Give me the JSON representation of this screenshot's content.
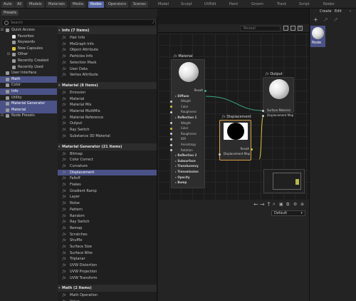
{
  "left_tabs": [
    "Auto",
    "All",
    "Models",
    "Materials",
    "Media",
    "Nodes",
    "Operators",
    "Scenes"
  ],
  "left_active_tab": "Nodes",
  "top_tabs": [
    "Model",
    "Sculpt",
    "UVEdit",
    "Paint",
    "Groom",
    "Track",
    "Script",
    "Nodes"
  ],
  "presets_tab": "Presets",
  "search": {
    "placeholder": "Search"
  },
  "tree": [
    {
      "label": "Quick Access",
      "expand": "⊟",
      "depth": 0,
      "icon": "#9a9a9a",
      "selected": false
    },
    {
      "label": "Favorites",
      "expand": "",
      "depth": 1,
      "icon": "#e0e0e0",
      "selected": false
    },
    {
      "label": "Keywords",
      "expand": "",
      "depth": 1,
      "icon": "#9a9a9a",
      "selected": false
    },
    {
      "label": "New Capsules",
      "expand": "",
      "depth": 1,
      "icon": "#d8c23a",
      "selected": false
    },
    {
      "label": "Other",
      "expand": "⊟",
      "depth": 1,
      "icon": "#9a9a9a",
      "selected": false
    },
    {
      "label": "Recently Created",
      "expand": "",
      "depth": 1,
      "icon": "#9a9a9a",
      "selected": false
    },
    {
      "label": "Recently Used",
      "expand": "",
      "depth": 1,
      "icon": "#9a9a9a",
      "selected": false
    },
    {
      "label": "User Interface",
      "expand": "",
      "depth": 0,
      "icon": "#9a9a9a",
      "selected": false
    },
    {
      "label": "Math",
      "expand": "",
      "depth": 0,
      "icon": "#9a9a9a",
      "selected": true
    },
    {
      "label": "Color",
      "expand": "",
      "depth": 0,
      "icon": "#9a9a9a",
      "selected": false
    },
    {
      "label": "Info",
      "expand": "",
      "depth": 0,
      "icon": "#9a9a9a",
      "selected": true
    },
    {
      "label": "Utility",
      "expand": "",
      "depth": 0,
      "icon": "#9a9a9a",
      "selected": false
    },
    {
      "label": "Material Generator",
      "expand": "",
      "depth": 0,
      "icon": "#9a9a9a",
      "selected": true
    },
    {
      "label": "Material",
      "expand": "",
      "depth": 0,
      "icon": "#9a9a9a",
      "selected": true
    },
    {
      "label": "Node Presets",
      "expand": "⊟",
      "depth": 0,
      "icon": "#9a9a9a",
      "selected": false
    }
  ],
  "groups": [
    {
      "title": "Info (7 Items)",
      "items": [
        "Hair Info",
        "MoGraph Info",
        "Object Attribute",
        "Particles Info",
        "Selection Mask",
        "User Data",
        "Vertex Attribute"
      ]
    },
    {
      "title": "Material (8 Items)",
      "items": [
        "Emission",
        "Material",
        "Material Mix",
        "Material MultiMix",
        "Material Reference",
        "Output",
        "Ray Switch",
        "Substance 3D Material"
      ]
    },
    {
      "title": "Material Generator (21 Items)",
      "items": [
        "Bitmap",
        "Color Correct",
        "Curvature",
        "Displacement",
        "Falloff",
        "Flakes",
        "Gradient Ramp",
        "Layer",
        "Noise",
        "Pattern",
        "Random",
        "Ray Switch",
        "Remap",
        "Scratches",
        "Shuffle",
        "Surface Size",
        "Surface Wire",
        "Triplanar",
        "UVW Distortion",
        "UVW Projection",
        "UVW Transform"
      ]
    },
    {
      "title": "Math (2 Items)",
      "items": [
        "Math Operation",
        "Value"
      ]
    }
  ],
  "selected_item": "Displacement",
  "editor": {
    "reveal_placeholder": "Reveal",
    "dropdown_value": "Default",
    "nodes": {
      "material": {
        "title": "Material",
        "rows": [
          {
            "label": "Result",
            "kind": "output"
          },
          {
            "label": "Diffuse",
            "kind": "section"
          },
          {
            "label": "Weight",
            "kind": "port",
            "color": "#cfcfcf"
          },
          {
            "label": "Color",
            "kind": "port",
            "color": "#d8c23a"
          },
          {
            "label": "Roughness",
            "kind": "port",
            "color": "#cfcfcf"
          },
          {
            "label": "Reflection 1",
            "kind": "section"
          },
          {
            "label": "Weight",
            "kind": "port",
            "color": "#cfcfcf"
          },
          {
            "label": "Color",
            "kind": "port",
            "color": "#d8c23a"
          },
          {
            "label": "Roughness",
            "kind": "port",
            "color": "#cfcfcf"
          },
          {
            "label": "IOR",
            "kind": "port",
            "color": "#cfcfcf"
          },
          {
            "label": "Anisotropy",
            "kind": "port",
            "color": "#cfcfcf"
          },
          {
            "label": "Rotation",
            "kind": "port",
            "color": "#cfcfcf"
          },
          {
            "label": "Reflection 2",
            "kind": "section"
          },
          {
            "label": "Subsurface",
            "kind": "section"
          },
          {
            "label": "Translucency",
            "kind": "section"
          },
          {
            "label": "Transmission",
            "kind": "section"
          },
          {
            "label": "Opacity",
            "kind": "section"
          },
          {
            "label": "Bump",
            "kind": "section"
          }
        ]
      },
      "output": {
        "title": "Output",
        "rows": [
          "Surface Material",
          "Displacement Map"
        ]
      },
      "displacement": {
        "title": "Displacement",
        "rows": [
          "Result",
          "Displacement Map"
        ]
      }
    }
  },
  "right": {
    "create": "Create",
    "edit": "Edit",
    "node_tile": "Node"
  },
  "colors": {
    "accent": "#5a6aa8",
    "selection": "#4b5287",
    "node_selected_border": "#d8a04a",
    "wire": "#3aa98a"
  }
}
